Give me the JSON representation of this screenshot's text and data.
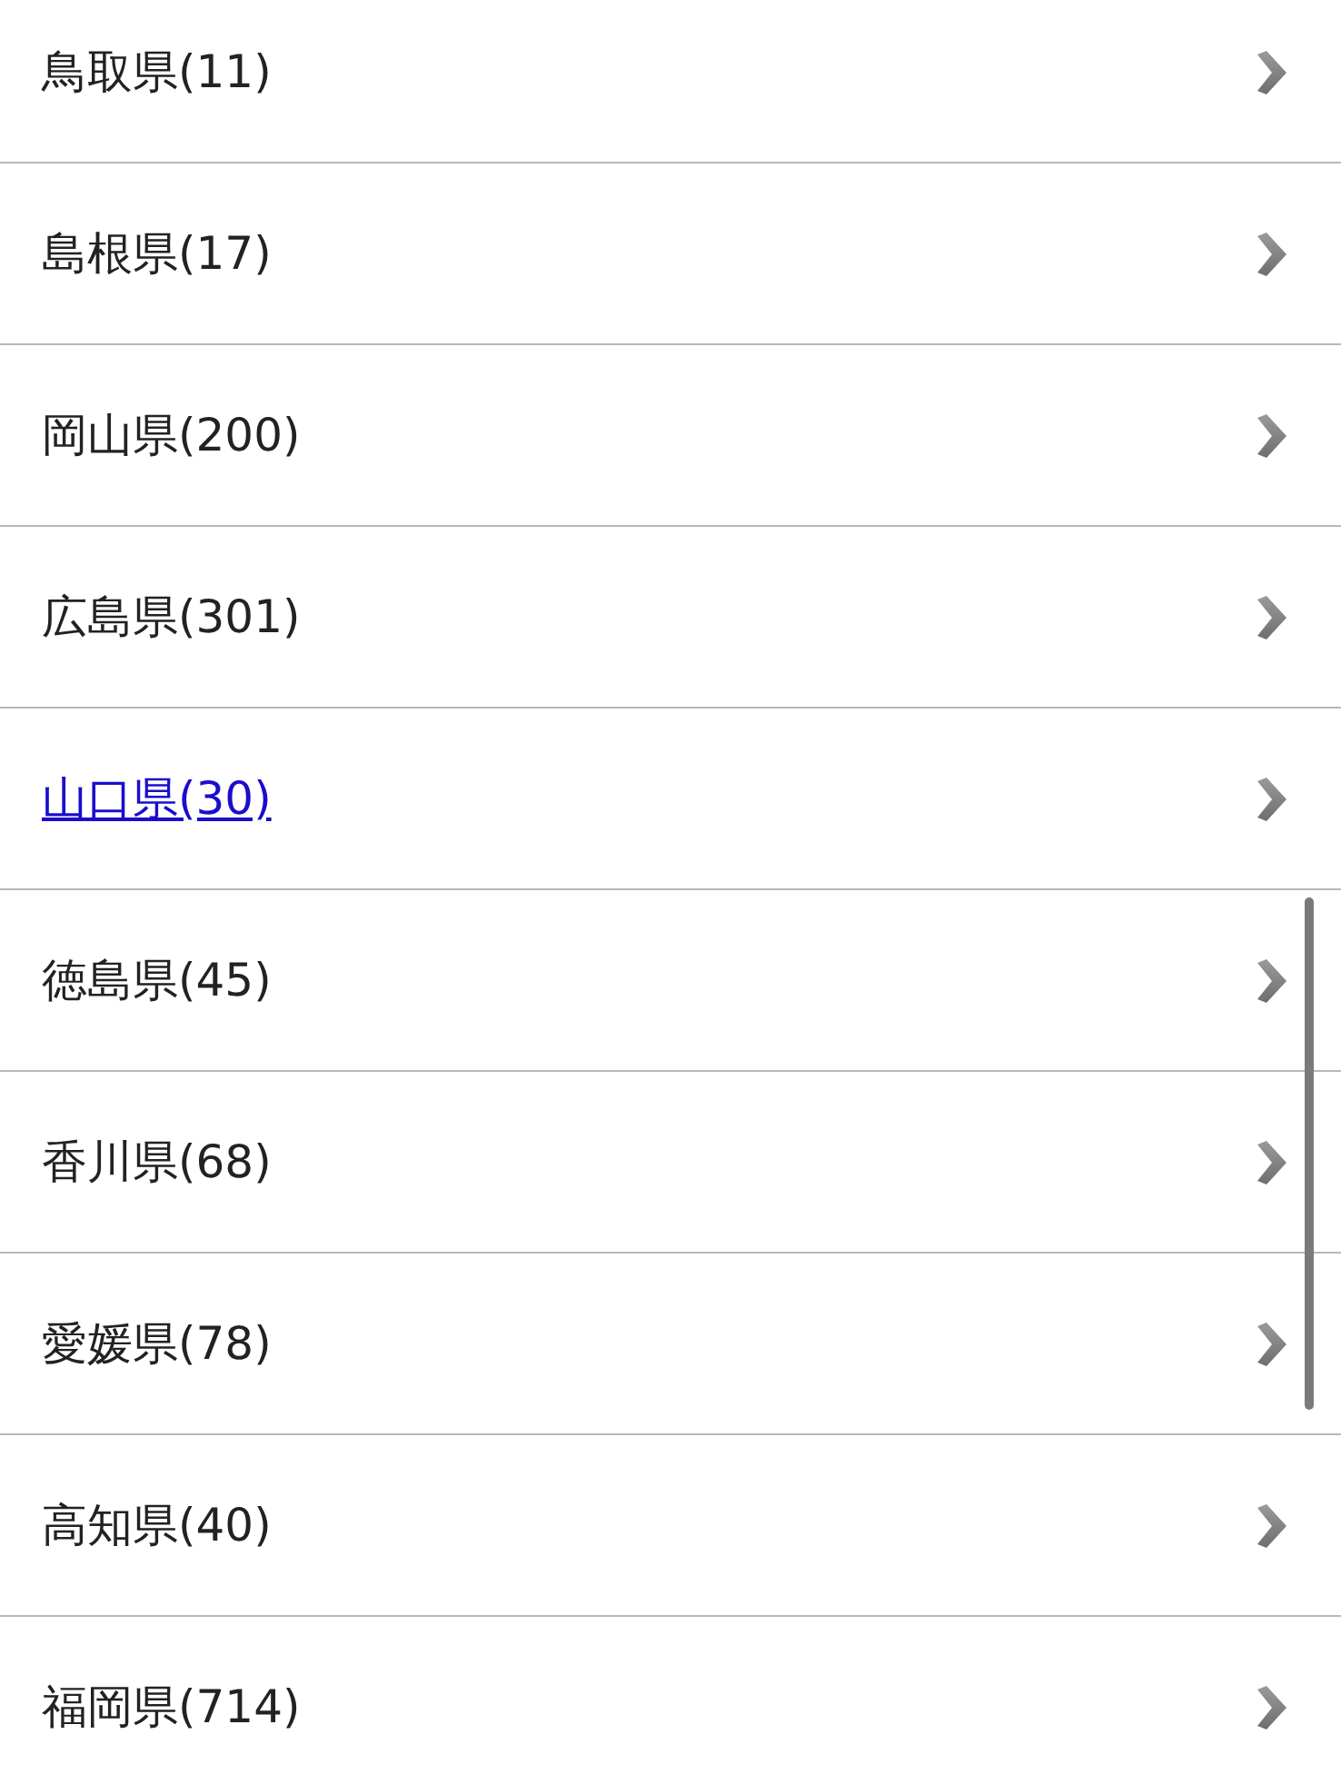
{
  "items": [
    {
      "label": "鳥取県(11)",
      "kind": "plain"
    },
    {
      "label": "島根県(17)",
      "kind": "plain"
    },
    {
      "label": "岡山県(200)",
      "kind": "plain"
    },
    {
      "label": "広島県(301)",
      "kind": "plain"
    },
    {
      "label": "山口県(30)",
      "kind": "link"
    },
    {
      "label": "徳島県(45)",
      "kind": "plain"
    },
    {
      "label": "香川県(68)",
      "kind": "plain"
    },
    {
      "label": "愛媛県(78)",
      "kind": "plain"
    },
    {
      "label": "高知県(40)",
      "kind": "plain"
    },
    {
      "label": "福岡県(714)",
      "kind": "plain"
    }
  ]
}
